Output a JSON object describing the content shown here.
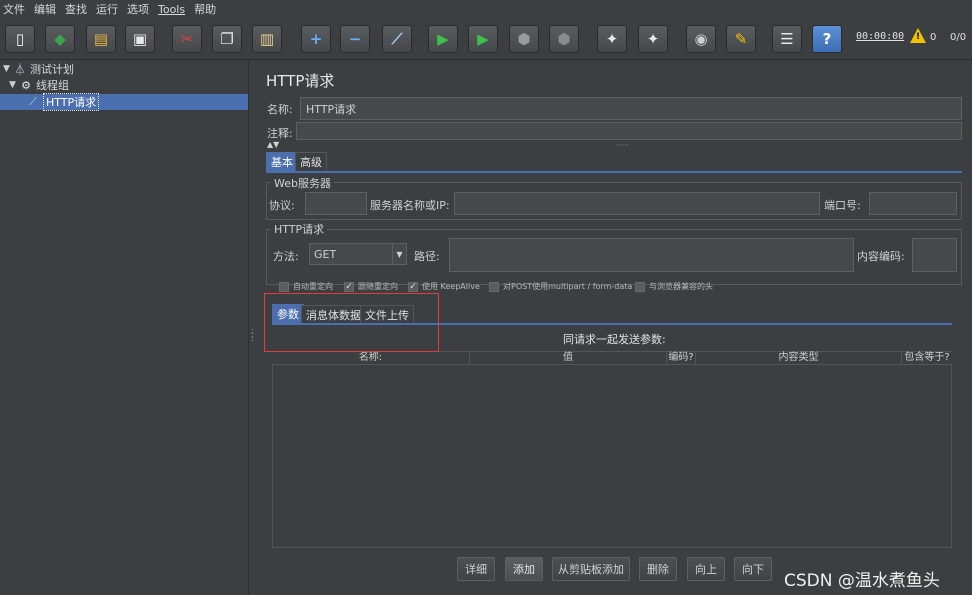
{
  "menu": [
    "文件",
    "编辑",
    "查找",
    "运行",
    "选项",
    "Tools",
    "帮助"
  ],
  "toolbar": {
    "buttons": [
      {
        "name": "new-icon",
        "glyph": "▯",
        "color": "#f5f5f5"
      },
      {
        "name": "templates-icon",
        "glyph": "◆",
        "color": "#3fa34d"
      },
      {
        "name": "open-icon",
        "glyph": "▤",
        "color": "#e8b23b"
      },
      {
        "name": "save-icon",
        "glyph": "▣",
        "color": "#e8e8e8"
      },
      {
        "name": "cut-icon",
        "glyph": "✂",
        "color": "#e04040"
      },
      {
        "name": "copy-icon",
        "glyph": "❐",
        "color": "#e8e8e8"
      },
      {
        "name": "paste-icon",
        "glyph": "▥",
        "color": "#e8d08a"
      },
      {
        "name": "expand-icon",
        "glyph": "+",
        "color": "#6aaef7"
      },
      {
        "name": "collapse-icon",
        "glyph": "−",
        "color": "#6aaef7"
      },
      {
        "name": "toggle-icon",
        "glyph": "⟋",
        "color": "#9fd0ff"
      },
      {
        "name": "start-icon",
        "glyph": "▶",
        "color": "#3cc24a"
      },
      {
        "name": "start-no-pause-icon",
        "glyph": "▶",
        "color": "#3cc24a"
      },
      {
        "name": "stop-icon",
        "glyph": "⬢",
        "color": "#9a9a9a"
      },
      {
        "name": "shutdown-icon",
        "glyph": "⬢",
        "color": "#8a8a8a"
      },
      {
        "name": "clear-icon",
        "glyph": "✦",
        "color": "#e8e8e8"
      },
      {
        "name": "clear-all-icon",
        "glyph": "✦",
        "color": "#e8e8e8"
      },
      {
        "name": "search-icon",
        "glyph": "◉",
        "color": "#d0d0d0"
      },
      {
        "name": "reset-search-icon",
        "glyph": "✎",
        "color": "#f2c200"
      },
      {
        "name": "function-helper-icon",
        "glyph": "☰",
        "color": "#e8e8e8"
      },
      {
        "name": "help-icon",
        "glyph": "?",
        "color": "#ffffff"
      }
    ],
    "timer": "00:00:00",
    "warnings": "0",
    "threads": "0/0"
  },
  "tree": {
    "root": "测试计划",
    "group": "线程组",
    "selected": "HTTP请求"
  },
  "panel": {
    "title": "HTTP请求",
    "name_label": "名称:",
    "name_value": "HTTP请求",
    "comment_label": "注释:",
    "comment_value": "",
    "tabs": [
      "基本",
      "高级"
    ],
    "web_server": {
      "title": "Web服务器",
      "protocol_label": "协议:",
      "protocol_value": "",
      "server_label": "服务器名称或IP:",
      "server_value": "",
      "port_label": "端口号:",
      "port_value": ""
    },
    "http_request": {
      "title": "HTTP请求",
      "method_label": "方法:",
      "method_value": "GET",
      "path_label": "路径:",
      "path_value": "",
      "encoding_label": "内容编码:",
      "encoding_value": ""
    },
    "options": [
      {
        "label": "自动重定向",
        "checked": false
      },
      {
        "label": "跟随重定向",
        "checked": true
      },
      {
        "label": "使用 KeepAlive",
        "checked": true
      },
      {
        "label": "对POST使用multipart / form-data",
        "checked": false
      },
      {
        "label": "与浏览器兼容的头",
        "checked": false
      }
    ],
    "sub_tabs": [
      "参数",
      "消息体数据",
      "文件上传"
    ],
    "table_hint": "同请求一起发送参数:",
    "columns": [
      "名称:",
      "值",
      "编码?",
      "内容类型",
      "包含等于?"
    ],
    "buttons": [
      "详细",
      "添加",
      "从剪贴板添加",
      "删除",
      "向上",
      "向下"
    ]
  },
  "watermark": "CSDN @温水煮鱼头"
}
